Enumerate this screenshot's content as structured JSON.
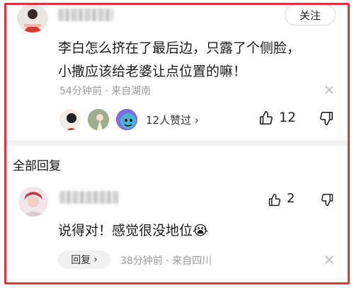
{
  "main_comment": {
    "follow_label": "关注",
    "text_line1": "李白怎么挤在了最后边，只露了个侧脸，",
    "text_line2": "小撒应该给老婆让点位置的嘛！",
    "time": "54分钟前",
    "separator": "·",
    "location": "来自湖南",
    "likers_summary": "12人赞过",
    "likers_chevron": "›",
    "like_count": "12"
  },
  "section": {
    "title": "全部回复"
  },
  "reply": {
    "text": "说得对！感觉很没地位",
    "emoji": "😭",
    "like_count": "2",
    "reply_label": "回复",
    "reply_chevron": "›",
    "time": "38分钟前",
    "separator": "·",
    "location": "来自四川"
  },
  "colors": {
    "highlight_border": "#e0323a",
    "meta_text": "#9a9a9a"
  }
}
